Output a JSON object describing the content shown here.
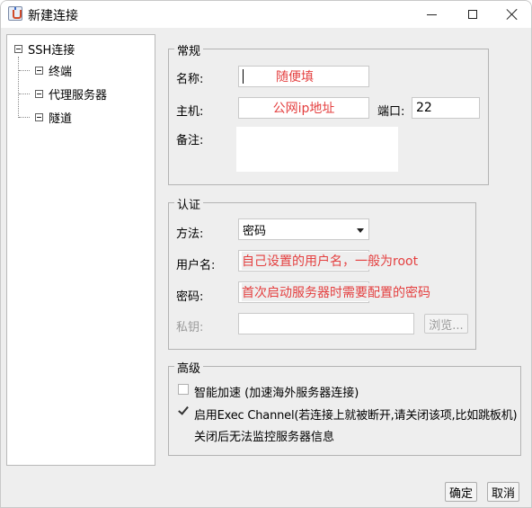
{
  "window": {
    "title": "新建连接"
  },
  "tree": {
    "root": "SSH连接",
    "children": [
      "终端",
      "代理服务器",
      "隧道"
    ]
  },
  "general": {
    "legend": "常规",
    "name_label": "名称:",
    "name_value": "随便填",
    "host_label": "主机:",
    "host_value": "公网ip地址",
    "port_label": "端口:",
    "port_value": "22",
    "note_label": "备注:",
    "note_value": ""
  },
  "auth": {
    "legend": "认证",
    "method_label": "方法:",
    "method_value": "密码",
    "user_label": "用户名:",
    "user_value": "自己设置的用户名，一般为root",
    "password_label": "密码:",
    "password_value": "首次启动服务器时需要配置的密码",
    "key_label": "私钥:",
    "key_value": "",
    "browse_label": "浏览..."
  },
  "advanced": {
    "legend": "高级",
    "smart_accel_label": "智能加速 (加速海外服务器连接)",
    "smart_accel_checked": false,
    "exec_channel_label": "启用Exec Channel(若连接上就被断开,请关闭该项,比如跳板机)",
    "exec_channel_checked": true,
    "exec_channel_note": "关闭后无法监控服务器信息"
  },
  "footer": {
    "ok_label": "确定",
    "cancel_label": "取消"
  },
  "colors": {
    "annotation_red": "#e43f3f",
    "window_bg": "#eeeeee"
  }
}
